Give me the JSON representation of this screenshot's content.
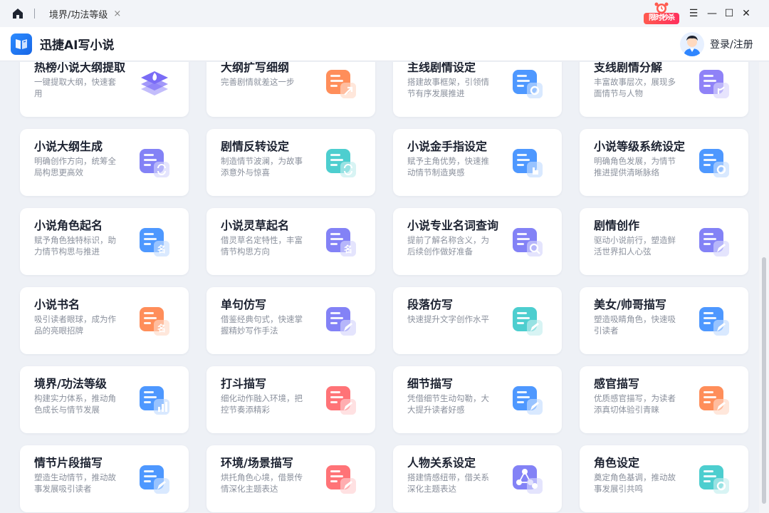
{
  "titlebar": {
    "tab_title": "境界/功法等级",
    "tab_close": "×",
    "promo_text": "限时秒杀",
    "menu": "☰",
    "minimize": "—",
    "maximize": "☐",
    "close": "✕"
  },
  "header": {
    "app_name": "迅捷AI写小说",
    "login": "登录/注册"
  },
  "colors": {
    "orange": "#ff7a3d",
    "blue": "#2f86ff",
    "purple": "#6d6cf5",
    "teal": "#2ec6c7",
    "red": "#ff5a5f",
    "violet": "#7b6cf6"
  },
  "cards": [
    {
      "title": "热榜小说大纲提取",
      "desc": "一键提取大纲，快速套用",
      "icon": "layers-fire-icon",
      "color": "#7a6cf6"
    },
    {
      "title": "大纲扩写细纲",
      "desc": "完善剧情就差这一步",
      "icon": "list-expand-icon",
      "color": "#ff7a3d"
    },
    {
      "title": "主线剧情设定",
      "desc": "搭建故事框架，引领情节有序发展推进",
      "icon": "doc-gear-icon",
      "color": "#2f86ff"
    },
    {
      "title": "支线剧情分解",
      "desc": "丰富故事层次，展现多面情节与人物",
      "icon": "doc-branch-icon",
      "color": "#7b6cf6"
    },
    {
      "title": "小说大纲生成",
      "desc": "明确创作方向，统筹全局构思更高效",
      "icon": "doc-refresh-icon",
      "color": "#6d6cf5"
    },
    {
      "title": "剧情反转设定",
      "desc": "制造情节波澜，为故事添意外与惊喜",
      "icon": "list-turn-icon",
      "color": "#2ec6c7"
    },
    {
      "title": "小说金手指设定",
      "desc": "赋予主角优势，快速推动情节制造爽感",
      "icon": "map-finger-icon",
      "color": "#2f86ff"
    },
    {
      "title": "小说等级系统设定",
      "desc": "明确角色发展，为情节推进提供清晰脉络",
      "icon": "star-gear-icon",
      "color": "#2f86ff"
    },
    {
      "title": "小说角色起名",
      "desc": "赋予角色独特标识，助力情节构思与推进",
      "icon": "mask-name-icon",
      "color": "#2f86ff"
    },
    {
      "title": "小说灵草起名",
      "desc": "借灵草名定特性，丰富情节构思方向",
      "icon": "leaf-name-icon",
      "color": "#6d6cf5"
    },
    {
      "title": "小说专业名词查询",
      "desc": "提前了解名称含义，为后续创作做好准备",
      "icon": "map-search-icon",
      "color": "#6d6cf5"
    },
    {
      "title": "剧情创作",
      "desc": "驱动小说前行，塑造鲜活世界扣人心弦",
      "icon": "doc-pen-icon",
      "color": "#6d6cf5"
    },
    {
      "title": "小说书名",
      "desc": "吸引读者眼球，成为作品的亮眼招牌",
      "icon": "book-name-icon",
      "color": "#ff7a3d"
    },
    {
      "title": "单句仿写",
      "desc": "借鉴经典句式，快速掌握精妙写作手法",
      "icon": "doc-edit-icon",
      "color": "#6d6cf5"
    },
    {
      "title": "段落仿写",
      "desc": "快速提升文字创作水平",
      "icon": "paragraph-edit-icon",
      "color": "#2ec6c7"
    },
    {
      "title": "美女/帅哥描写",
      "desc": "塑造吸睛角色，快速吸引读者",
      "icon": "face-edit-icon",
      "color": "#2f86ff"
    },
    {
      "title": "境界/功法等级",
      "desc": "构建实力体系，推动角色成长与情节发展",
      "icon": "person-chart-icon",
      "color": "#2f86ff"
    },
    {
      "title": "打斗描写",
      "desc": "细化动作融入环境，把控节奏添精彩",
      "icon": "fist-edit-icon",
      "color": "#ff5a5f"
    },
    {
      "title": "细节描写",
      "desc": "凭借细节生动勾勒，大大提升读者好感",
      "icon": "atom-edit-icon",
      "color": "#2f86ff"
    },
    {
      "title": "感官描写",
      "desc": "优质感官描写，为读者添真切体验引青睐",
      "icon": "lips-edit-icon",
      "color": "#ff7a3d"
    },
    {
      "title": "情节片段描写",
      "desc": "塑造生动情节，推动故事发展吸引读者",
      "icon": "play-edit-icon",
      "color": "#2f86ff"
    },
    {
      "title": "环境/场景描写",
      "desc": "烘托角色心境，借景传情深化主题表达",
      "icon": "scene-edit-icon",
      "color": "#ff5a5f"
    },
    {
      "title": "人物关系设定",
      "desc": "搭建情感纽带，借关系深化主题表达",
      "icon": "network-icon",
      "color": "#6d6cf5"
    },
    {
      "title": "角色设定",
      "desc": "奠定角色基调，推动故事发展引共鸣",
      "icon": "mask-gear-icon",
      "color": "#2ec6c7"
    }
  ]
}
